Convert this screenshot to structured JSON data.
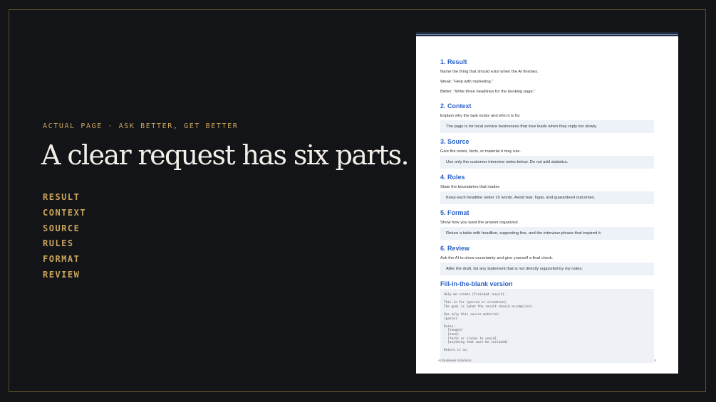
{
  "slide": {
    "eyebrow": "ACTUAL PAGE · ASK BETTER, GET BETTER",
    "headline": "A clear request has six parts.",
    "parts": [
      "RESULT",
      "CONTEXT",
      "SOURCE",
      "RULES",
      "FORMAT",
      "REVIEW"
    ]
  },
  "document": {
    "sections": [
      {
        "heading": "1. Result",
        "text": "Name the thing that should exist when the AI finishes.",
        "weak": "Weak: “Help with marketing.”",
        "better": "Better: “Write three headlines for the booking page.”"
      },
      {
        "heading": "2. Context",
        "text": "Explain why the task exists and who it is for.",
        "example": "The page is for local service businesses that lose leads when they reply too slowly."
      },
      {
        "heading": "3. Source",
        "text": "Give the notes, facts, or material it may use.",
        "example": "Use only the customer interview notes below. Do not add statistics."
      },
      {
        "heading": "4. Rules",
        "text": "State the boundaries that matter.",
        "example": "Keep each headline under 10 words. Avoid fear, hype, and guaranteed outcomes."
      },
      {
        "heading": "5. Format",
        "text": "Show how you want the answer organized.",
        "example": "Return a table with headline, supporting line, and the interview phrase that inspired it."
      },
      {
        "heading": "6. Review",
        "text": "Ask the AI to show uncertainty and give yourself a final check.",
        "example": "After the draft, list any statement that is not directly supported by my notes."
      }
    ],
    "template_heading": "Fill-in-the-blank version",
    "template_lines": [
      "Help me create [finished result].",
      "",
      "This is for [person or situation].",
      "The goal is [what the result should accomplish].",
      "",
      "Use only this source material:",
      "[paste]",
      "",
      "Rules:",
      "- [length]",
      "- [tone]",
      "- [facts or claims to avoid]",
      "- [anything that must be included]",
      "",
      "Return it as:"
    ],
    "footer_left": "AI Business Solutions",
    "footer_page": "4"
  }
}
